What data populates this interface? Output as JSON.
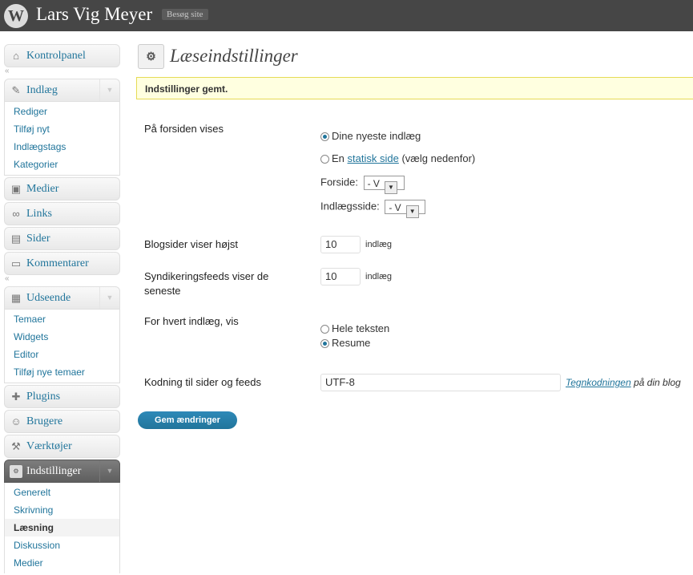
{
  "header": {
    "site_title": "Lars Vig Meyer",
    "visit_site": "Besøg site"
  },
  "menu": {
    "dashboard": "Kontrolpanel",
    "posts": {
      "label": "Indlæg",
      "items": [
        "Rediger",
        "Tilføj nyt",
        "Indlægstags",
        "Kategorier"
      ]
    },
    "media": "Medier",
    "links": "Links",
    "pages": "Sider",
    "comments": "Kommentarer",
    "appearance": {
      "label": "Udseende",
      "items": [
        "Temaer",
        "Widgets",
        "Editor",
        "Tilføj nye temaer"
      ]
    },
    "plugins": "Plugins",
    "users": "Brugere",
    "tools": "Værktøjer",
    "settings": {
      "label": "Indstillinger",
      "items": [
        "Generelt",
        "Skrivning",
        "Læsning",
        "Diskussion",
        "Medier"
      ]
    }
  },
  "page": {
    "title": "Læseindstillinger",
    "notice": "Indstillinger gemt."
  },
  "form": {
    "front_label": "På forsiden vises",
    "opt_latest": "Dine nyeste indlæg",
    "opt_static_pre": "En",
    "opt_static_link": "statisk side",
    "opt_static_post": "(vælg nedenfor)",
    "frontpage_label": "Forside:",
    "frontpage_value": "- V",
    "postspage_label": "Indlægsside:",
    "postspage_value": "- V",
    "blog_pages_label": "Blogsider viser højst",
    "blog_pages_value": "10",
    "blog_pages_unit": "indlæg",
    "feeds_label_1": "Syndikeringsfeeds viser de",
    "feeds_label_2": "seneste",
    "feeds_value": "10",
    "feeds_unit": "indlæg",
    "each_label": "For hvert indlæg, vis",
    "opt_full": "Hele teksten",
    "opt_summary": "Resume",
    "encoding_label": "Kodning til sider og feeds",
    "encoding_value": "UTF-8",
    "encoding_link": "Tegnkodningen",
    "encoding_desc": "på din blog",
    "save": "Gem ændringer"
  }
}
